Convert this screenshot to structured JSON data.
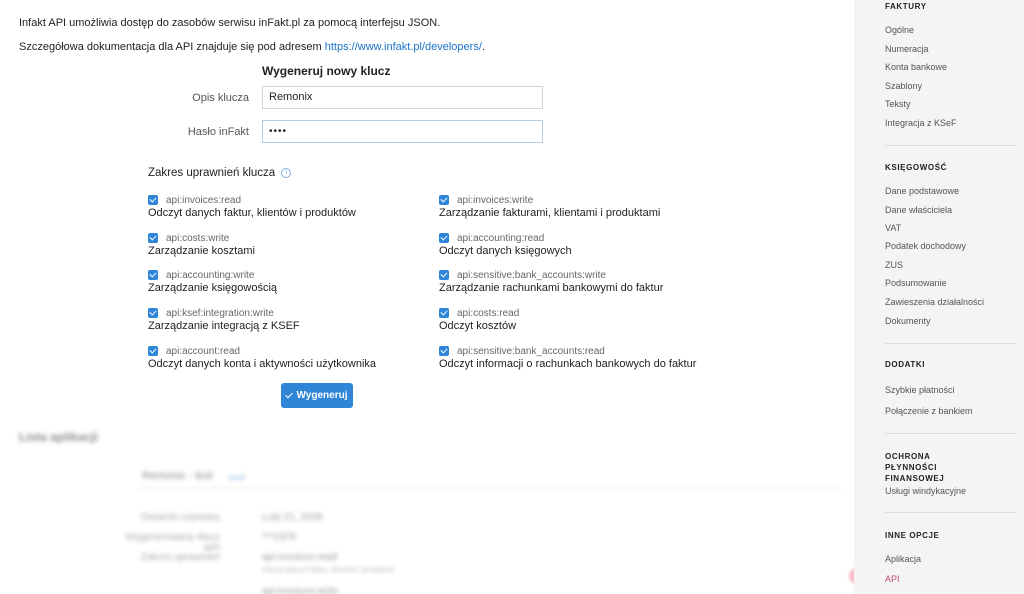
{
  "intro": {
    "line1": "Infakt API umożliwia dostęp do zasobów serwisu inFakt.pl za pomocą interfejsu JSON.",
    "line2_prefix": "Szczegółowa dokumentacja dla API znajduje się pod adresem ",
    "line2_link": "https://www.infakt.pl/developers/",
    "line2_suffix": "."
  },
  "form": {
    "title": "Wygeneruj nowy klucz",
    "description_label": "Opis klucza",
    "description_value": "Remonix",
    "password_label": "Hasło inFakt",
    "password_value": "••••",
    "scope_title": "Zakres uprawnień klucza",
    "info_icon": "info-icon",
    "generate_label": "Wygeneruj"
  },
  "permissions": [
    {
      "scope": "api:invoices:read",
      "desc": "Odczyt danych faktur, klientów i produktów",
      "checked": true
    },
    {
      "scope": "api:invoices:write",
      "desc": "Zarządzanie fakturami, klientami i produktami",
      "checked": true
    },
    {
      "scope": "api:costs:write",
      "desc": "Zarządzanie kosztami",
      "checked": true
    },
    {
      "scope": "api:accounting:read",
      "desc": "Odczyt danych księgowych",
      "checked": true
    },
    {
      "scope": "api:accounting:write",
      "desc": "Zarządzanie księgowością",
      "checked": true
    },
    {
      "scope": "api:sensitive:bank_accounts:write",
      "desc": "Zarządzanie rachunkami bankowymi do faktur",
      "checked": true
    },
    {
      "scope": "api:ksef:integration:write",
      "desc": "Zarządzanie integracją z KSEF",
      "checked": true
    },
    {
      "scope": "api:costs:read",
      "desc": "Odczyt kosztów",
      "checked": true
    },
    {
      "scope": "api:account:read",
      "desc": "Odczyt danych konta i aktywności użytkownika",
      "checked": true
    },
    {
      "scope": "api:sensitive:bank_accounts:read",
      "desc": "Odczyt informacji o rachunkach bankowych do faktur",
      "checked": true
    }
  ],
  "apps": {
    "title": "Lista aplikacji",
    "app_name": "Remonix - test",
    "app_link": "usuń",
    "rows": [
      {
        "label": "Ostatnio używany",
        "value": "Luty 21, 2026"
      },
      {
        "label": "Wygenerowany klucz API",
        "value": "***2376"
      },
      {
        "label": "Zakres uprawnień",
        "value": "api:invoices:read",
        "sub": "Odczyt danych faktur, klientów i produktów"
      },
      {
        "label": "",
        "value": "api:invoices:write"
      }
    ]
  },
  "sidebar": {
    "sections": [
      {
        "title": "FAKTURY",
        "items": [
          "Ogólne",
          "Numeracja",
          "Konta bankowe",
          "Szablony",
          "Teksty",
          "Integracja z KSeF"
        ]
      },
      {
        "title": "KSIĘGOWOŚĆ",
        "items": [
          "Dane podstawowe",
          "Dane właściciela",
          "VAT",
          "Podatek dochodowy",
          "ZUS",
          "Podsumowanie",
          "Zawieszenia działalności",
          "Dokumenty"
        ]
      },
      {
        "title": "DODATKI",
        "items": [
          "Szybkie płatności",
          "Połączenie z bankiem"
        ]
      },
      {
        "title": "OCHRONA PŁYNNOŚCI FINANSOWEJ",
        "items": [
          "Usługi windykacyjne"
        ]
      },
      {
        "title": "INNE OPCJE",
        "items": [
          "Aplikacja",
          "API"
        ]
      }
    ],
    "active_item": "API",
    "active_color": "#c24a7a",
    "accent_color": "#2f86d9"
  }
}
